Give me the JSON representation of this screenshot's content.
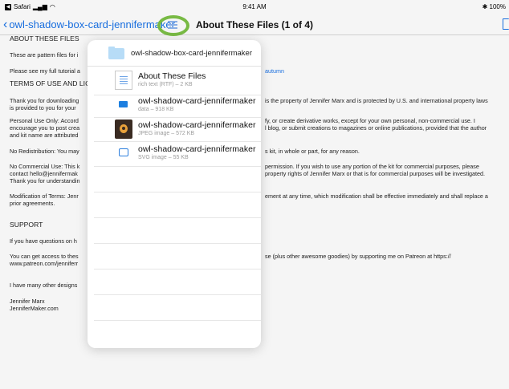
{
  "status_bar": {
    "back_app": "Safari",
    "time": "9:41 AM",
    "battery": "100%"
  },
  "navbar": {
    "back_label": "owl-shadow-box-card-jennifermaker",
    "title": "About These Files (1 of 4)",
    "list_icon": "list-icon",
    "share_icon": "share-icon",
    "highlight_color": "#7dc247"
  },
  "document": {
    "heading_about": "ABOUT THESE FILES",
    "line_pattern": "These are pattern files for i",
    "line_tutorial": "Please see my full tutorial a",
    "tutorial_link": "autumn",
    "heading_terms": "TERMS OF USE AND LICE",
    "thanks_l1": "Thank you for downloading",
    "thanks_l2": "is provided to you for your",
    "thanks_r": "is the property of Jennifer Marx and is protected by U.S. and international property laws",
    "personal_l1": "Personal Use Only: Accord",
    "personal_l2": "encourage you to post crea",
    "personal_l3": "and kit name are attributed",
    "personal_r1": "fy, or create derivative works, except for your own personal, non-commercial use. I",
    "personal_r2": "l blog, or submit creations to magazines or online publications, provided that the author",
    "noredist_l": "No Redistribution: You may",
    "noredist_r": "s kit, in whole or part, for any reason.",
    "nocommercial_l1": "No Commercial Use: This k",
    "nocommercial_l2": "contact hello@jennifermak",
    "nocommercial_l3": "Thank you for understandin",
    "nocommercial_r1": "permission. If you wish to use any portion of the kit for commercial purposes, please",
    "nocommercial_r2": "property rights of Jennifer Marx or that is for commercial purposes will be investigated.",
    "modification_l1": "Modification of Terms: Jenr",
    "modification_l2": "prior agreements.",
    "modification_r": "ement at any time, which modification shall be effective immediately and shall replace a",
    "heading_support": "SUPPORT",
    "questions_l": "If you have questions on h",
    "access_l1": "You can get access to thes",
    "access_l2": "www.patreon.com/jenniferr",
    "access_r": "se (plus other awesome goodies) by supporting me on Patreon at https://",
    "designs_l": "I have many other designs",
    "sig_name": "Jennifer Marx",
    "sig_site": "JenniferMaker.com"
  },
  "popover": {
    "folder_title": "owl-shadow-box-card-jennifermaker",
    "files": [
      {
        "name": "About These Files",
        "meta": "rich text (RTF) – 2 KB",
        "icon": "rtf-document-icon"
      },
      {
        "name": "owl-shadow-card-jennifermaker",
        "meta": "data – 918 KB",
        "icon": "data-file-icon"
      },
      {
        "name": "owl-shadow-card-jennifermaker",
        "meta": "JPEG image – 572 KB",
        "icon": "jpeg-thumbnail-icon"
      },
      {
        "name": "owl-shadow-card-jennifermaker",
        "meta": "SVG image – 55 KB",
        "icon": "svg-file-icon"
      }
    ]
  }
}
